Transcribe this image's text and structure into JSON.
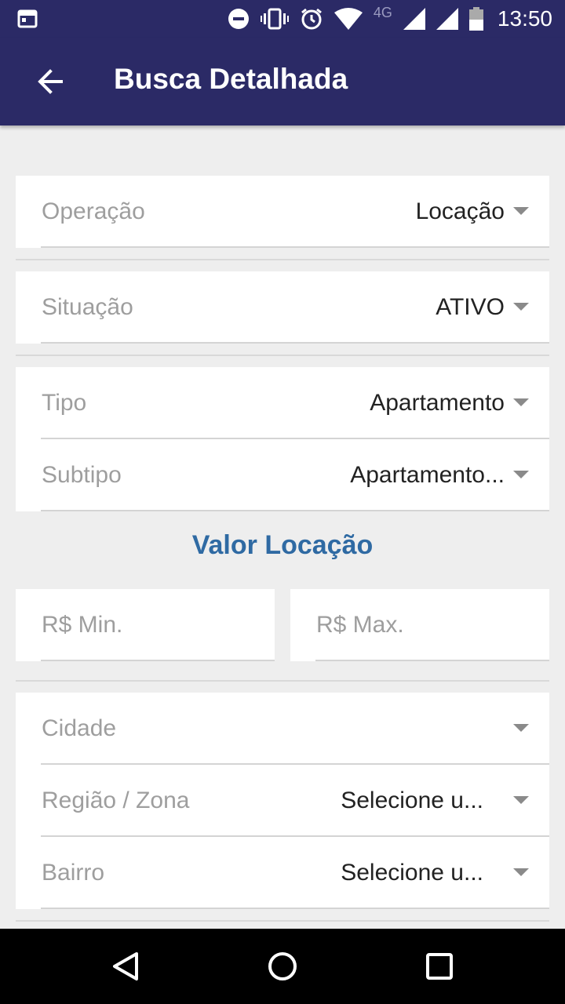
{
  "status_bar": {
    "time": "13:50",
    "network": "4G",
    "icons": [
      "calendar-icon",
      "dnd-icon",
      "vibrate-icon",
      "alarm-icon",
      "wifi-icon",
      "signal-icon",
      "signal-icon-2",
      "battery-icon"
    ]
  },
  "app_bar": {
    "title": "Busca Detalhada"
  },
  "filters": {
    "operacao": {
      "label": "Operação",
      "value": "Locação"
    },
    "situacao": {
      "label": "Situação",
      "value": "ATIVO"
    },
    "tipo": {
      "label": "Tipo",
      "value": "Apartamento"
    },
    "subtipo": {
      "label": "Subtipo",
      "value": "Apartamento..."
    }
  },
  "valor": {
    "title": "Valor Locação",
    "min_placeholder": "R$ Min.",
    "max_placeholder": "R$ Max."
  },
  "location": {
    "cidade": {
      "label": "Cidade",
      "value": ""
    },
    "regiao": {
      "label": "Região / Zona",
      "value": "Selecione u..."
    },
    "bairro": {
      "label": "Bairro",
      "value": "Selecione u..."
    }
  },
  "colors": {
    "primary": "#2b2a66",
    "accent": "#2f6aa3",
    "background": "#eeeeee"
  }
}
